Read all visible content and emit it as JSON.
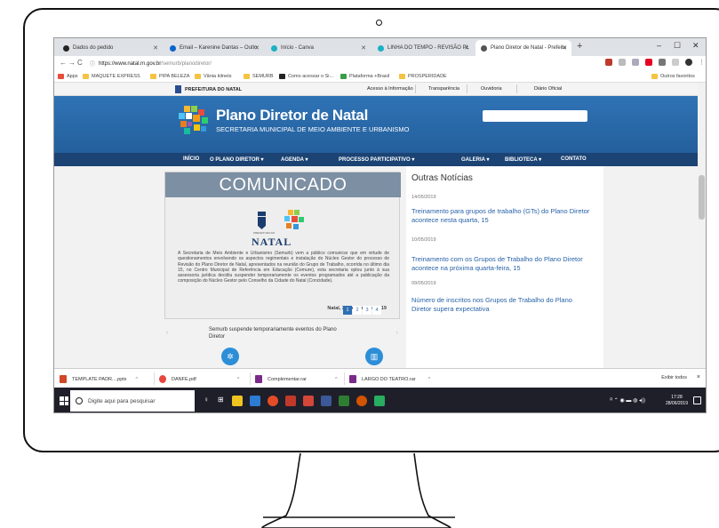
{
  "browser": {
    "tabs": [
      {
        "label": "Dados do pedido",
        "favicon": "amazon-icon",
        "color": "#222222"
      },
      {
        "label": "Email – Karenine Dantas – Outlo",
        "favicon": "outlook-icon",
        "color": "#0a64c8"
      },
      {
        "label": "Início - Canva",
        "favicon": "canva-icon",
        "color": "#1ab0c4"
      },
      {
        "label": "LINHA DO TEMPO - REVISÃO PL",
        "favicon": "canva-icon",
        "color": "#1ab0c4"
      },
      {
        "label": "Plano Diretor de Natal - Prefeitu",
        "favicon": "site-icon",
        "color": "#555555"
      }
    ],
    "new_tab": "+",
    "url_domain": "https://www.natal.rn.gov.br",
    "url_path": "/semurb/planodiretor/",
    "bookmarks": [
      "Apps",
      "MAQUETE EXPRESS",
      "PIPA BELEZA",
      "Vânia kitnets",
      "SEMURB",
      "Como acessar o Si...",
      "Plataforma +Brasil",
      "PROSPERIDADE"
    ],
    "other_bookmarks": "Outros favoritos"
  },
  "site": {
    "gov_name": "PREFEITURA DO NATAL",
    "gov_links": [
      "Acesso à Informação",
      "Transparência",
      "Ouvidoria",
      "Diário Oficial"
    ],
    "title": "Plano Diretor de Natal",
    "subtitle": "SECRETARIA MUNICIPAL DE MEIO AMBIENTE E URBANISMO",
    "menu": [
      "INÍCIO",
      "O PLANO DIRETOR ▾",
      "AGENDA ▾",
      "PROCESSO PARTICIPATIVO ▾",
      "GALERIA ▾",
      "BIBLIOTECA ▾",
      "CONTATO"
    ],
    "slide": {
      "heading": "COMUNICADO",
      "prefeitura_small": "PREFEITURA DO",
      "natal": "NATAL",
      "body": "A Secretaria de Meio Ambiente e Urbanismo (Semurb) vem a público comunicar que em virtude de questionamentos envolvendo os aspectos regimentais e instalação do Núcleo Gestor do processo de Revisão do Plano Diretor de Natal, apresentados na reunião do Grupo de Trabalho, ocorrida no último dia 15, no Centro Municipal de Referência em Educação (Cemure), esta secretaria optou junto à sua assessoria jurídica decidiu suspender temporariamente os eventos programados até a publicação da composição do Núcleo Gestor pelo Conselho da Cidade do Natal (Concidade).",
      "date": "Natal, 21 de maio de 2019",
      "pages": [
        "1",
        "2",
        "3",
        "4"
      ],
      "caption": "Semurb suspende temporariamente eventos do Plano Diretor"
    },
    "news_heading": "Outras Notícias",
    "news": [
      {
        "date": "14/05/2019",
        "title": "Treinamento para grupos de trabalho (GTs) do Plano Diretor acontece nesta quarta, 15"
      },
      {
        "date": "10/05/2019",
        "title": "Treinamento com os Grupos de Trabalho do Plano Diretor acontece na próxima quarta-feira, 15"
      },
      {
        "date": "09/05/2019",
        "title": "Número de inscritos nos Grupos de Trabalho do Plano Diretor supera expectativa"
      }
    ]
  },
  "downloads": {
    "items": [
      {
        "name": "TEMPLATE PADR....pptx",
        "color": "#d24726"
      },
      {
        "name": "DANFE.pdf",
        "color": "#e8453c"
      },
      {
        "name": "Complementar.rar",
        "color": "#7a2b8a"
      },
      {
        "name": "LARGO DO TEATRO.rar",
        "color": "#7a2b8a"
      }
    ],
    "show_all": "Exibir todos",
    "close": "×"
  },
  "taskbar": {
    "search_placeholder": "Digite aqui para pesquisar",
    "time": "17:28",
    "date": "28/06/2019",
    "apps": [
      "#f0c420",
      "#2b7cd3",
      "#e34c26",
      "#c0392b",
      "#d44638",
      "#3b5998",
      "#2e7d32",
      "#d35400",
      "#27ae60"
    ]
  }
}
